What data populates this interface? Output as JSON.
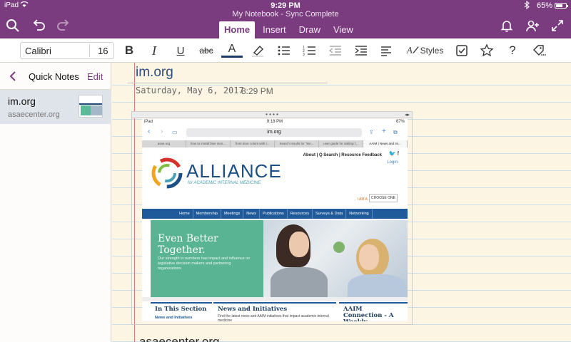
{
  "status_bar": {
    "device": "iPad",
    "time": "9:29 PM",
    "battery": "65%"
  },
  "header": {
    "doc_title": "My Notebook - Sync Complete"
  },
  "tabs": [
    {
      "label": "Home",
      "active": true
    },
    {
      "label": "Insert",
      "active": false
    },
    {
      "label": "Draw",
      "active": false
    },
    {
      "label": "View",
      "active": false
    }
  ],
  "ribbon": {
    "font_name": "Calibri",
    "font_size": "16",
    "bold": "B",
    "italic": "I",
    "underline": "U",
    "strike": "abc",
    "font_color": "A",
    "styles_label": "Styles"
  },
  "sidebar": {
    "title": "Quick Notes",
    "edit_label": "Edit",
    "pages": [
      {
        "title": "im.org",
        "subtitle": "asaecenter.org"
      }
    ]
  },
  "page": {
    "title": "im.org",
    "date": "Saturday, May 6, 2017",
    "time": "8:29 PM",
    "next_title": "asaecenter.org"
  },
  "screenshot": {
    "status_left": "iPad",
    "status_time": "9:18 PM",
    "status_right": "67%",
    "url": "im.org",
    "browser_tabs": [
      "asae.org",
      "how to install blue ston...",
      "front door colors with l...",
      "Search results for \"ten...",
      "user guide for adding f...",
      "AAIM | News and Ini..."
    ],
    "top_links": "About | Q Search | Resource Feedback",
    "login": "Login",
    "brand": "ALLIANCE",
    "brand_sub": "for ACADEMIC INTERNAL MEDICINE",
    "i_am_a": "I AM A",
    "choose_one": "CHOOSE ONE",
    "menu": [
      "Home",
      "Membership",
      "Meetings",
      "News",
      "Publications",
      "Resources",
      "Surveys & Data",
      "Networking"
    ],
    "hero_heading": "Even Better Together.",
    "hero_text": "Our strength in numbers has impact and influence on legislative decision makers and partnering organizations.",
    "card1_title": "In This Section",
    "card1_link": "News and Initiatives",
    "card2_title": "News and Initiatives",
    "card2_text": "Find the latest news and AAIM initiatives that impact academic internal medicine",
    "card3_title": "AAIM Connection - A Weekly Newsletter"
  },
  "colors": {
    "brand_purple": "#7a3c7e",
    "page_bg": "#fdf5e4",
    "rule_blue": "#c9dee8",
    "margin_red": "#e07a7a"
  }
}
